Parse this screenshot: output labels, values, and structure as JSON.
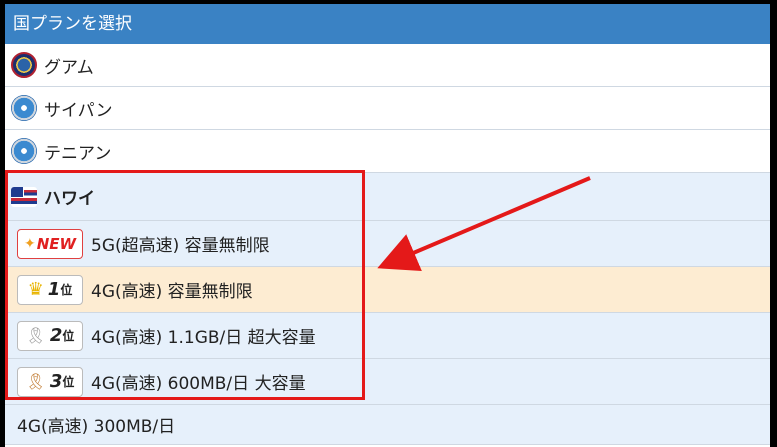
{
  "header": {
    "title": "国プランを選択"
  },
  "countries": [
    {
      "label": "グアム",
      "flag_icon": "guam-flag-icon"
    },
    {
      "label": "サイパン",
      "flag_icon": "nmi-flag-icon"
    },
    {
      "label": "テニアン",
      "flag_icon": "nmi-flag-icon"
    }
  ],
  "hawaii": {
    "label": "ハワイ",
    "flag_icon": "hawaii-flag-icon",
    "plans": [
      {
        "badge_text": "NEW",
        "badge_icon": "sparkle-icon",
        "label": "5G(超高速) 容量無制限"
      },
      {
        "badge_rank": "1",
        "badge_suffix": "位",
        "badge_icon": "crown-icon",
        "label": "4G(高速) 容量無制限"
      },
      {
        "badge_rank": "2",
        "badge_suffix": "位",
        "badge_icon": "silver-medal-icon",
        "label": "4G(高速) 1.1GB/日 超大容量"
      },
      {
        "badge_rank": "3",
        "badge_suffix": "位",
        "badge_icon": "bronze-medal-icon",
        "label": "4G(高速) 600MB/日 大容量"
      }
    ],
    "extra_plan": {
      "label": "4G(高速) 300MB/日"
    }
  },
  "colors": {
    "header_bg": "#3a82c4",
    "plan_bg": "#e6f0fb",
    "top_plan_bg": "#fdecd2",
    "annotation_red": "#e41919"
  }
}
